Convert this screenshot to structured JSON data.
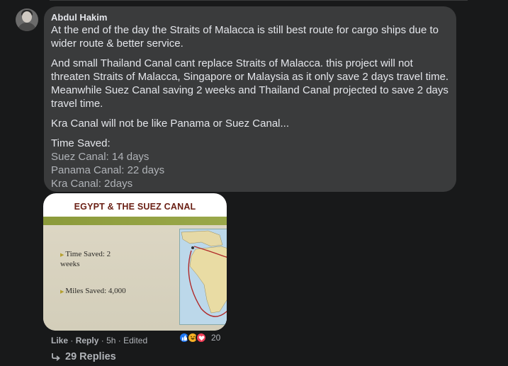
{
  "comment": {
    "author": "Abdul Hakim",
    "paragraphs": [
      "At the end of the day the Straits of Malacca is still best route for cargo ships due to wider route & better service.",
      "And small Thailand Canal cant replace Straits of Malacca. this project will not threaten Straits of Malacca, Singapore or Malaysia as it only save 2 days travel time. Meanwhile Suez Canal saving 2 weeks and Thailand Canal projected to save 2 days travel time.",
      "Kra Canal will not be like Panama or Suez Canal..."
    ],
    "list_heading": "Time Saved:",
    "list_items": [
      "Suez Canal: 14 days",
      "Panama Canal: 22 days",
      "Kra Canal: 2days"
    ]
  },
  "attachment": {
    "title": "EGYPT & THE SUEZ CANAL",
    "bullets": [
      "Time Saved: 2 weeks",
      "Miles Saved: 4,000"
    ]
  },
  "actions": {
    "like": "Like",
    "reply": "Reply",
    "time": "5h",
    "edited": "Edited",
    "separator": "·"
  },
  "reactions": {
    "count": "20",
    "types": [
      "like",
      "haha",
      "love"
    ],
    "colors": {
      "like": "#2078f4",
      "haha": "#f7b125",
      "love": "#f33e58"
    }
  },
  "replies": {
    "label": "29 Replies"
  }
}
